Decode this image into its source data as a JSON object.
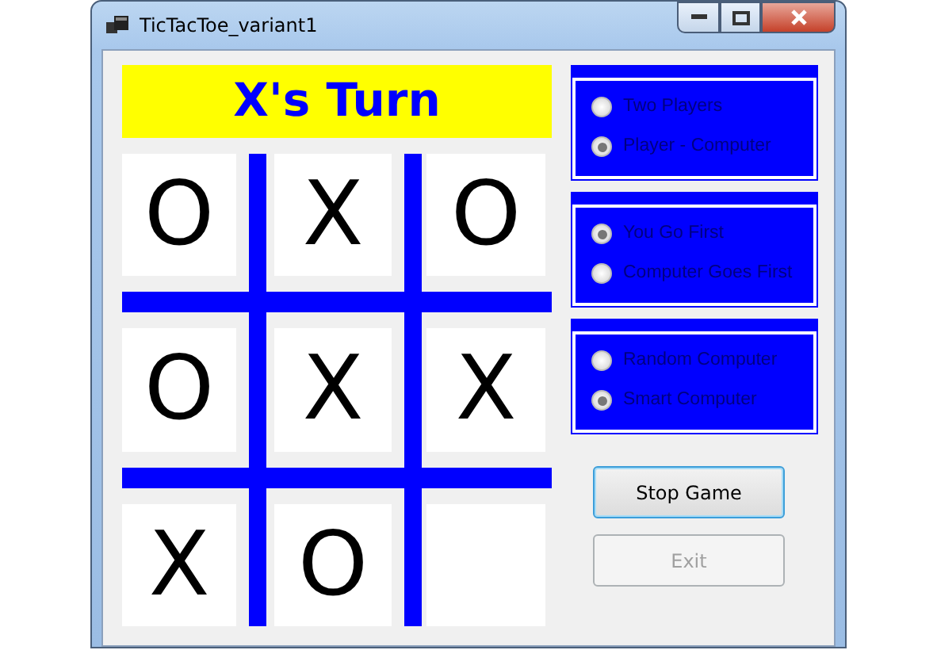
{
  "window": {
    "title": "TicTacToe_variant1"
  },
  "turn_banner": "X's Turn",
  "board": [
    {
      "kind": "marked",
      "mark": "O"
    },
    {
      "kind": "marked",
      "mark": "X"
    },
    {
      "kind": "marked",
      "mark": "O"
    },
    {
      "kind": "marked",
      "mark": "O"
    },
    {
      "kind": "marked",
      "mark": "X"
    },
    {
      "kind": "marked",
      "mark": "X"
    },
    {
      "kind": "marked",
      "mark": "X"
    },
    {
      "kind": "marked",
      "mark": "O"
    },
    {
      "kind": "empty"
    }
  ],
  "option_groups": [
    {
      "options": [
        {
          "label": "Two Players",
          "selected": false
        },
        {
          "label": "Player - Computer",
          "selected": true
        }
      ]
    },
    {
      "options": [
        {
          "label": "You Go First",
          "selected": true
        },
        {
          "label": "Computer Goes First",
          "selected": false
        }
      ]
    },
    {
      "options": [
        {
          "label": "Random Computer",
          "selected": false
        },
        {
          "label": "Smart Computer",
          "selected": true
        }
      ]
    }
  ],
  "buttons": [
    {
      "label": "Stop Game",
      "disabled": false,
      "focused": true
    },
    {
      "label": "Exit",
      "disabled": true,
      "focused": false
    }
  ]
}
